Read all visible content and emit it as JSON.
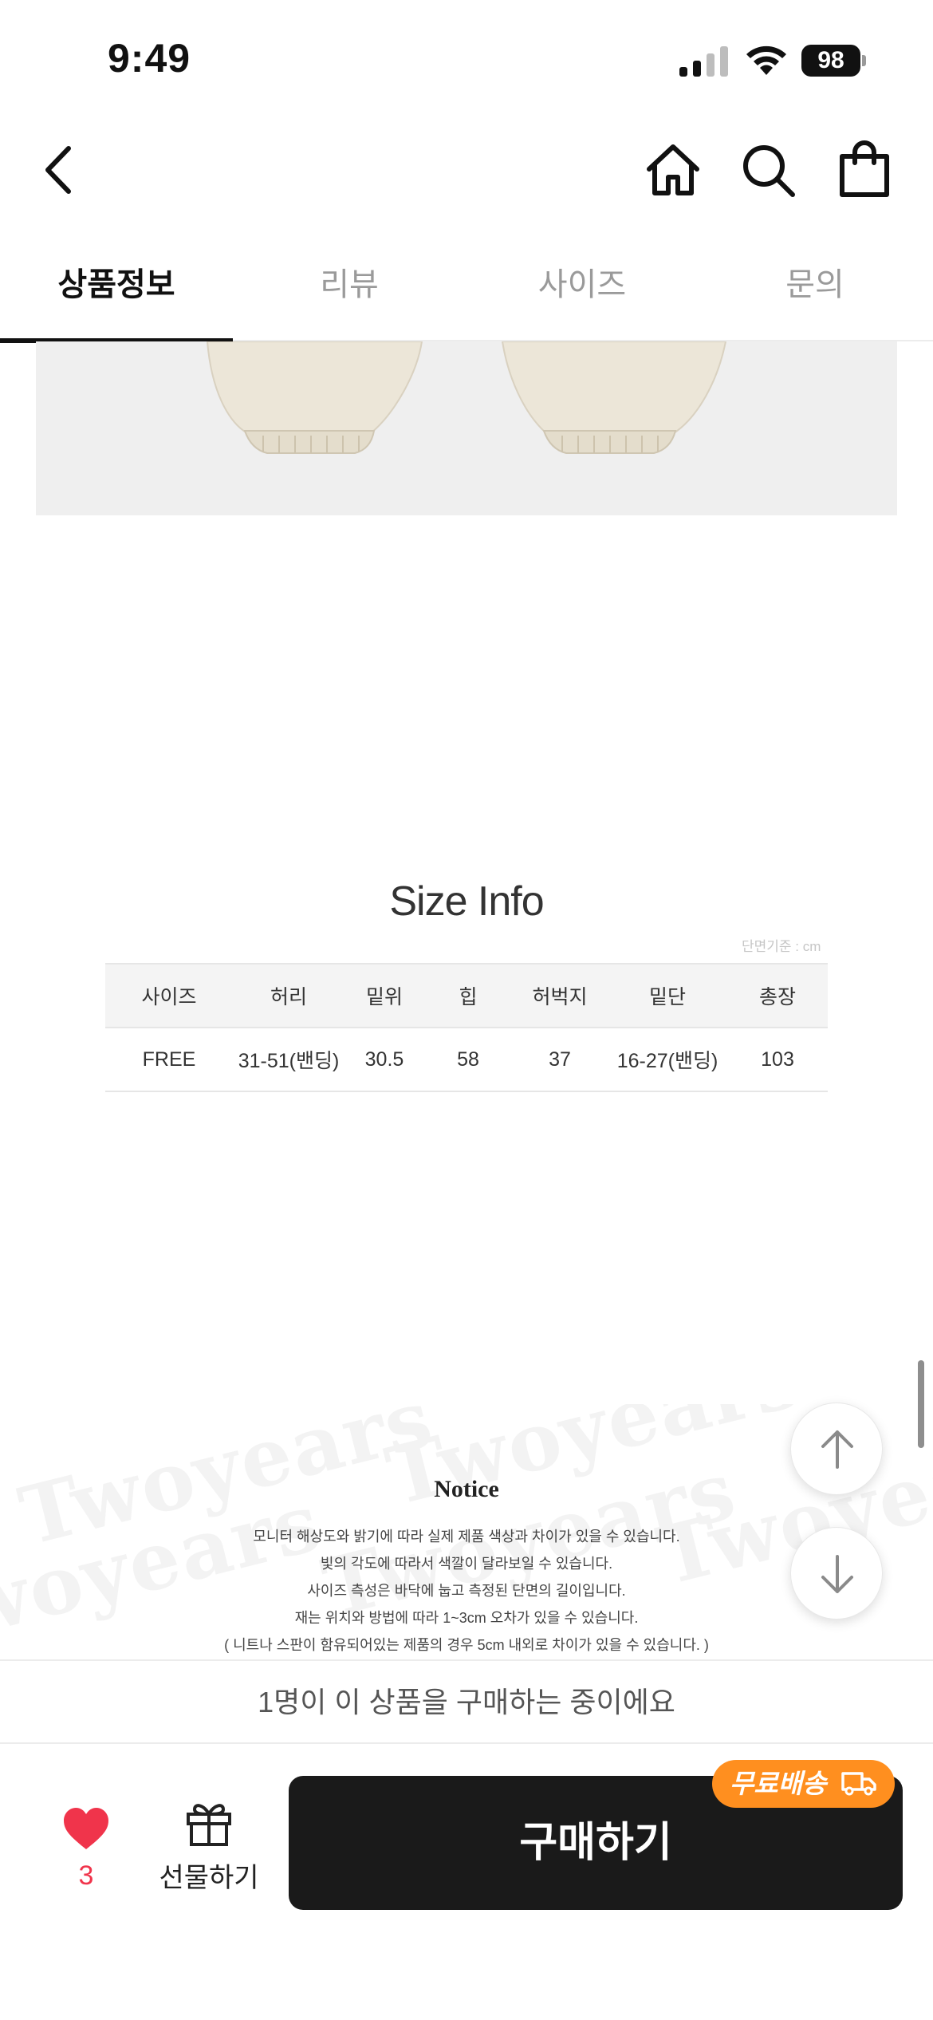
{
  "status_bar": {
    "time": "9:49",
    "battery": "98"
  },
  "nav": {
    "back_icon": "chevron-left-icon",
    "home_icon": "home-icon",
    "search_icon": "search-icon",
    "bag_icon": "shopping-bag-icon"
  },
  "tabs": [
    {
      "label": "상품정보",
      "active": true
    },
    {
      "label": "리뷰",
      "active": false
    },
    {
      "label": "사이즈",
      "active": false
    },
    {
      "label": "문의",
      "active": false
    }
  ],
  "size_info": {
    "title": "Size Info",
    "unit_note": "단면기준 : cm",
    "headers": [
      "사이즈",
      "허리",
      "밑위",
      "힙",
      "허벅지",
      "밑단",
      "총장"
    ],
    "rows": [
      [
        "FREE",
        "31-51(밴딩)",
        "30.5",
        "58",
        "37",
        "16-27(밴딩)",
        "103"
      ]
    ]
  },
  "notice": {
    "title": "Notice",
    "watermark_text": "Twoyears",
    "lines": [
      "모니터 해상도와 밝기에 따라 실제 제품 색상과 차이가 있을 수 있습니다.",
      "빛의 각도에 따라서 색깔이 달라보일 수 있습니다.",
      "사이즈 측성은 바닥에 눕고 측정된 단면의 길이입니다.",
      "재는 위치와 방법에 따라 1~3cm 오차가 있을 수 있습니다.",
      "( 니트나 스판이 함유되어있는 제품의 경우 5cm 내외로 차이가 있을 수 있습니다. )"
    ]
  },
  "floating": {
    "up_icon": "arrow-up-icon",
    "down_icon": "arrow-down-icon"
  },
  "bottom": {
    "buying_banner": "1명이 이 상품을 구매하는 중이에요",
    "like_count": "3",
    "gift_label": "선물하기",
    "buy_label": "구매하기",
    "free_shipping_badge": "무료배송",
    "like_color": "#f0344b",
    "badge_color": "#ff8f1f"
  }
}
